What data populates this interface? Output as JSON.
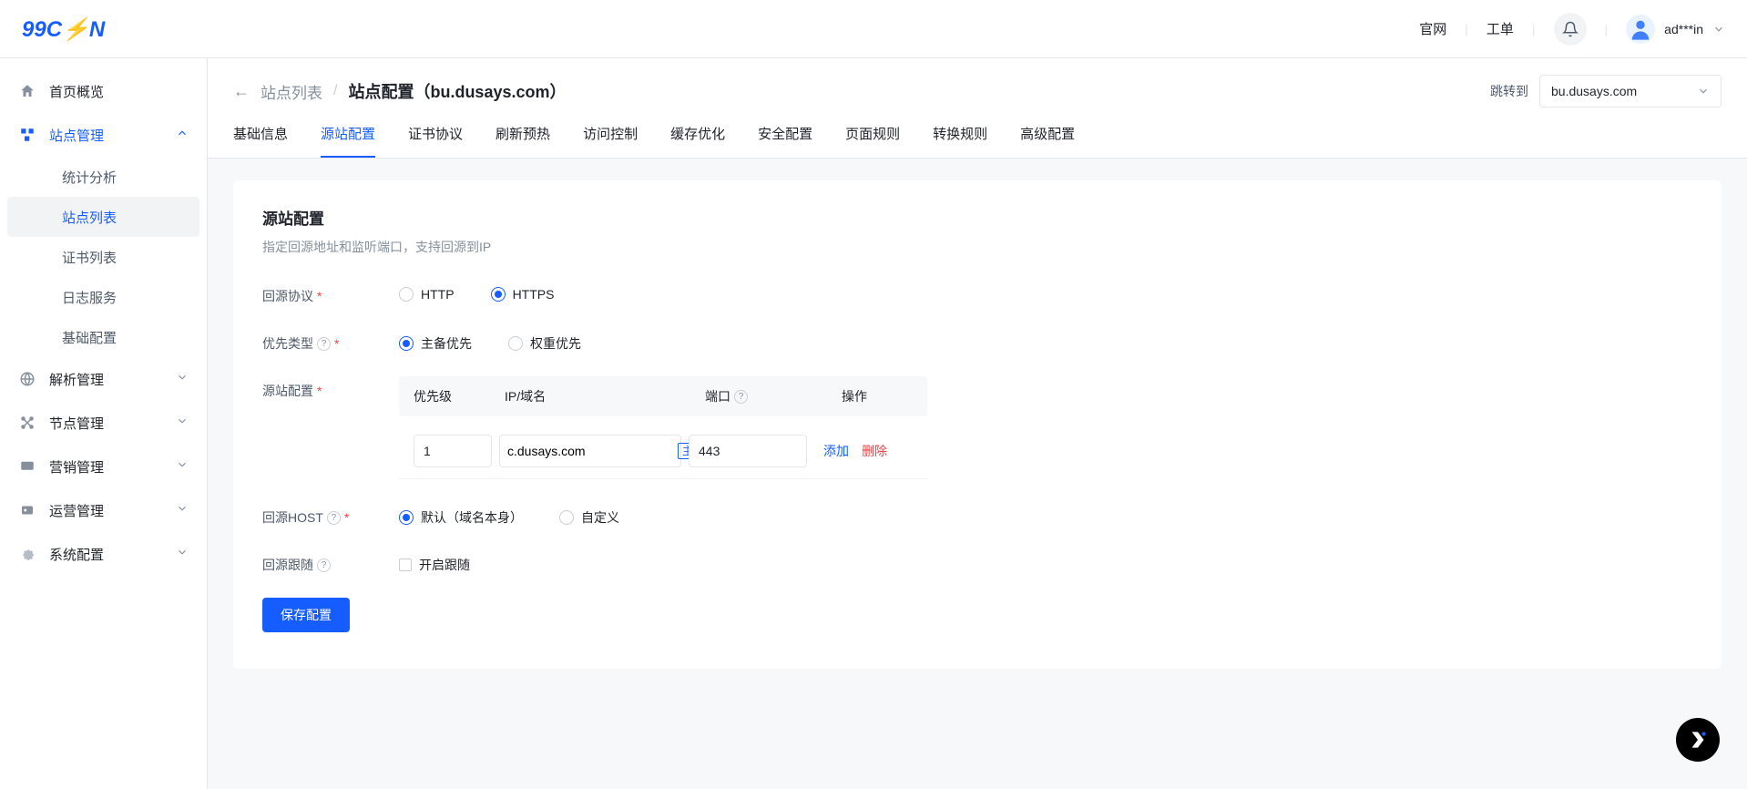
{
  "header": {
    "official_site": "官网",
    "ticket": "工单",
    "username": "ad***in"
  },
  "sidebar": {
    "items": [
      {
        "label": "首页概览",
        "icon": "home"
      },
      {
        "label": "站点管理",
        "icon": "sites",
        "active": true,
        "expanded": true,
        "children": [
          {
            "label": "统计分析"
          },
          {
            "label": "站点列表",
            "active": true
          },
          {
            "label": "证书列表"
          },
          {
            "label": "日志服务"
          },
          {
            "label": "基础配置"
          }
        ]
      },
      {
        "label": "解析管理",
        "icon": "dns"
      },
      {
        "label": "节点管理",
        "icon": "nodes"
      },
      {
        "label": "营销管理",
        "icon": "marketing"
      },
      {
        "label": "运营管理",
        "icon": "ops"
      },
      {
        "label": "系统配置",
        "icon": "settings"
      }
    ]
  },
  "breadcrumb": {
    "back_label": "站点列表",
    "current": "站点配置（bu.dusays.com）",
    "jump_label": "跳转到",
    "jump_value": "bu.dusays.com"
  },
  "tabs": [
    "基础信息",
    "源站配置",
    "证书协议",
    "刷新预热",
    "访问控制",
    "缓存优化",
    "安全配置",
    "页面规则",
    "转换规则",
    "高级配置"
  ],
  "active_tab_index": 1,
  "form": {
    "section_title": "源站配置",
    "section_desc": "指定回源地址和监听端口，支持回源到IP",
    "protocol_label": "回源协议",
    "protocol_options": [
      "HTTP",
      "HTTPS"
    ],
    "protocol_selected": "HTTPS",
    "priority_type_label": "优先类型",
    "priority_type_options": [
      "主备优先",
      "权重优先"
    ],
    "priority_type_selected": "主备优先",
    "origin_config_label": "源站配置",
    "table": {
      "col_priority": "优先级",
      "col_domain": "IP/域名",
      "col_port": "端口",
      "col_action": "操作",
      "rows": [
        {
          "priority": "1",
          "domain": "c.dusays.com",
          "badge": "主",
          "port": "443"
        }
      ],
      "action_add": "添加",
      "action_delete": "删除"
    },
    "host_label": "回源HOST",
    "host_options": [
      "默认（域名本身）",
      "自定义"
    ],
    "host_selected": "默认（域名本身）",
    "follow_label": "回源跟随",
    "follow_checkbox_label": "开启跟随",
    "save_button": "保存配置"
  }
}
